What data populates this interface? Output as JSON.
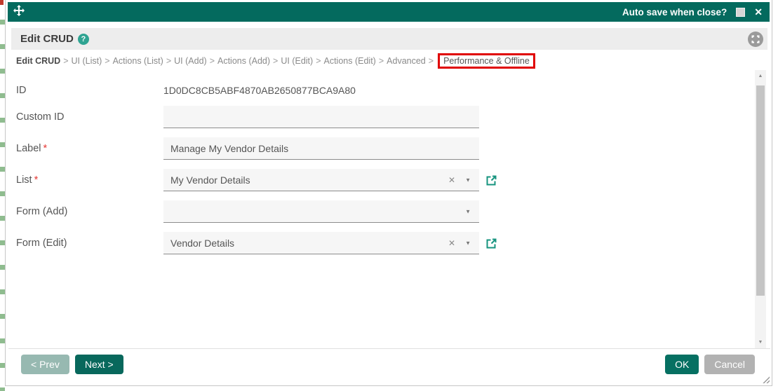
{
  "titlebar": {
    "autosave_label": "Auto save when close?"
  },
  "panel": {
    "title": "Edit CRUD"
  },
  "breadcrumb": {
    "separator": ">",
    "items": [
      "Edit CRUD",
      "UI (List)",
      "Actions (List)",
      "UI (Add)",
      "Actions (Add)",
      "UI (Edit)",
      "Actions (Edit)",
      "Advanced",
      "Performance & Offline"
    ]
  },
  "form": {
    "required_marker": "*",
    "fields": [
      {
        "label": "ID",
        "value": "1D0DC8CB5ABF4870AB2650877BCA9A80"
      },
      {
        "label": "Custom ID",
        "value": ""
      },
      {
        "label": "Label",
        "value": "Manage My Vendor Details"
      },
      {
        "label": "List",
        "value": "My Vendor Details"
      },
      {
        "label": "Form (Add)",
        "value": ""
      },
      {
        "label": "Form (Edit)",
        "value": "Vendor Details"
      }
    ]
  },
  "footer": {
    "prev": "< Prev",
    "next": "Next >",
    "ok": "OK",
    "cancel": "Cancel"
  },
  "icons": {
    "help": "?",
    "close": "✕",
    "clear": "✕",
    "caret": "▼",
    "scroll_up": "▲",
    "scroll_down": "▼"
  },
  "colors": {
    "titlebar_teal": "#046a5e",
    "button_teal": "#08685c",
    "help_teal": "#2fa492",
    "external_icon_teal": "#17947f",
    "highlight_red": "#e00000",
    "prev_muted": "#97b9b1",
    "cancel_gray": "#b2b2b2"
  }
}
